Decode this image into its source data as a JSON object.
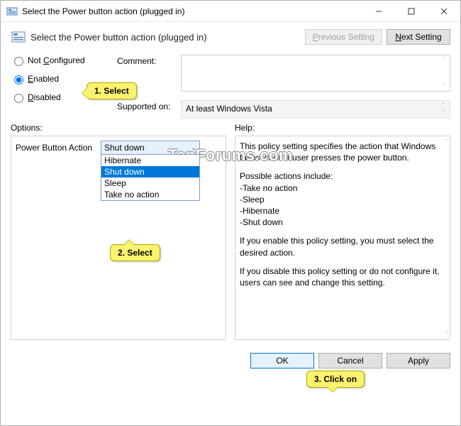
{
  "title": "Select the Power button action (plugged in)",
  "subtitle": "Select the Power button action (plugged in)",
  "buttons": {
    "prev": "Previous Setting",
    "next": "Next Setting",
    "ok": "OK",
    "cancel": "Cancel",
    "apply": "Apply"
  },
  "radios": {
    "not_configured": "Not Configured",
    "enabled": "Enabled",
    "disabled": "Disabled"
  },
  "labels": {
    "comment": "Comment:",
    "supported": "Supported on:",
    "options": "Options:",
    "help": "Help:",
    "power_button": "Power Button Action"
  },
  "supported_value": "At least Windows Vista",
  "dropdown": {
    "value": "Shut down",
    "items": [
      "Hibernate",
      "Shut down",
      "Sleep",
      "Take no action"
    ],
    "selected_index": 1
  },
  "help": [
    "This policy setting specifies the action that Windows takes when a user presses the power button.",
    "Possible actions include:\n-Take no action\n-Sleep\n-Hibernate\n-Shut down",
    "If you enable this policy setting, you must select the desired action.",
    "If you disable this policy setting or do not configure it, users can see and change this setting."
  ],
  "callouts": {
    "c1": "1. Select",
    "c2": "2. Select",
    "c3": "3. Click on"
  },
  "watermark": "TenForums.com"
}
